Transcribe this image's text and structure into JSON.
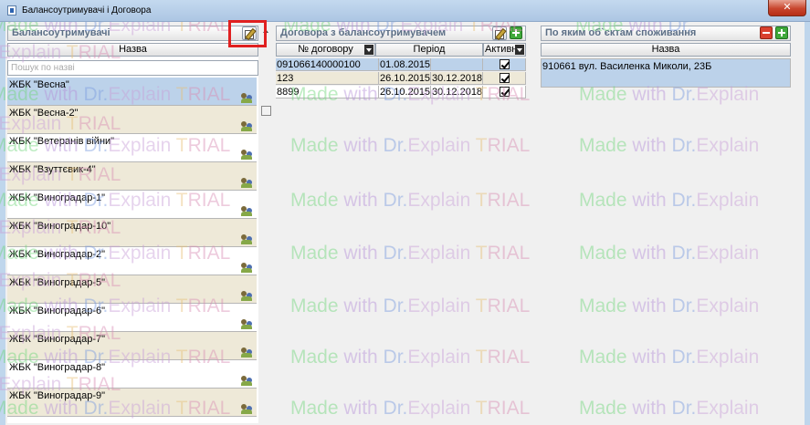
{
  "window": {
    "title": "Балансоутримувачі і Договора",
    "close_glyph": "✕"
  },
  "left_panel": {
    "header": "Балансоутримувачі",
    "column_name": "Назва",
    "search_placeholder": "Пошук по назві",
    "items": [
      {
        "label": "ЖБК \"Весна\""
      },
      {
        "label": "ЖБК \"Весна-2\""
      },
      {
        "label": "ЖБК \"Ветеранів війни\""
      },
      {
        "label": "ЖБК \"Взуттєвик-4\""
      },
      {
        "label": "ЖБК \"Виноградар-1\""
      },
      {
        "label": "ЖБК \"Виноградар-10\""
      },
      {
        "label": "ЖБК \"Виноградар-2\""
      },
      {
        "label": "ЖБК \"Виноградар-5\""
      },
      {
        "label": "ЖБК \"Виноградар-6\""
      },
      {
        "label": "ЖБК \"Виноградар-7\""
      },
      {
        "label": "ЖБК \"Виноградар-8\""
      },
      {
        "label": "ЖБК \"Виноградар-9\""
      }
    ]
  },
  "contracts_panel": {
    "header": "Договора з балансоутримувачем",
    "columns": {
      "number": "№ договору",
      "period": "Період",
      "active": "Активн"
    },
    "rows": [
      {
        "number": "091066140000100",
        "period_start": "01.08.2015",
        "period_end": "",
        "active": true
      },
      {
        "number": "123",
        "period_start": "26.10.2015",
        "period_end": "30.12.2018",
        "active": true
      },
      {
        "number": "8899",
        "period_start": "26.10.2015",
        "period_end": "30.12.2018",
        "active": true
      }
    ]
  },
  "objects_panel": {
    "header": "По яким об`єктам споживання",
    "column_name": "Назва",
    "rows": [
      {
        "label": "910661 вул. Василенка Миколи, 23Б"
      }
    ]
  },
  "watermark": {
    "made": "Made",
    "with": " with ",
    "dr": "Dr.",
    "explain": "Explain ",
    "t": "T",
    "rial": "RIAL"
  },
  "colors": {
    "selection": "#bcd2ea",
    "alt_row": "#eee9d8",
    "highlight": "#e02020",
    "add_button": "#3fa93a",
    "remove_button": "#d9412e"
  }
}
